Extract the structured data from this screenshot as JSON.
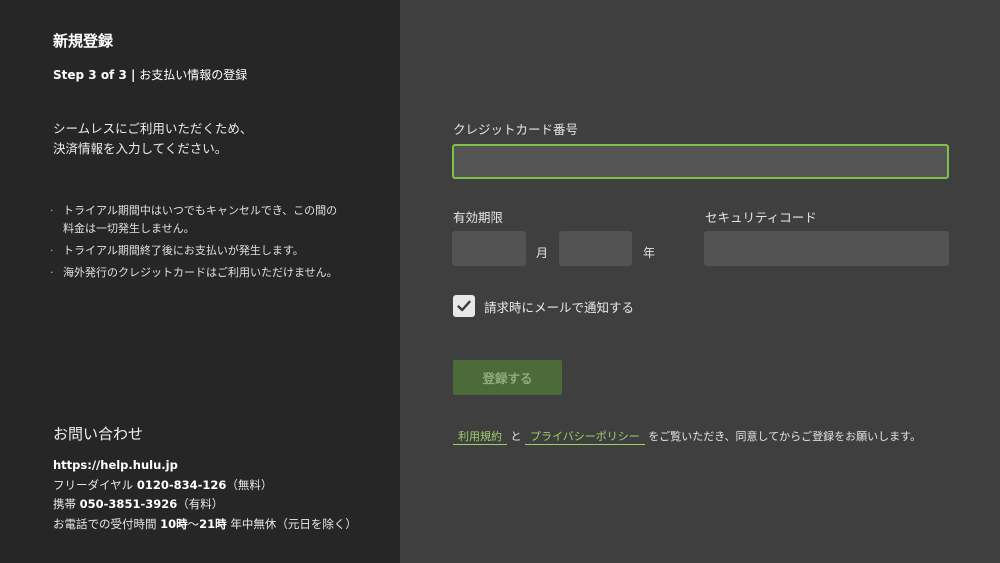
{
  "left": {
    "title": "新規登録",
    "step_prefix": "Step 3 of 3 |",
    "step_text": "お支払い情報の登録",
    "intro_line1": "シームレスにご利用いただくため、",
    "intro_line2": "決済情報を入力してください。",
    "notes": [
      "トライアル期間中はいつでもキャンセルでき、この間の料金は一切発生しません。",
      "トライアル期間終了後にお支払いが発生します。",
      "海外発行のクレジットカードはご利用いただけません。"
    ],
    "contact": {
      "title": "お問い合わせ",
      "url": "https://help.hulu.jp",
      "free_dial_label": "フリーダイヤル",
      "free_dial_number": "0120-834-126",
      "free_dial_note": "（無料）",
      "mobile_label": "携帯",
      "mobile_number": "050-3851-3926",
      "mobile_note": "（有料）",
      "hours_prefix": "お電話での受付時間",
      "hours_start": "10時",
      "hours_sep": "〜",
      "hours_end": "21時",
      "hours_suffix": "年中無休（元日を除く）"
    }
  },
  "form": {
    "card_number_label": "クレジットカード番号",
    "card_number_value": "",
    "expiry_label": "有効期限",
    "month_value": "",
    "month_unit": "月",
    "year_value": "",
    "year_unit": "年",
    "security_label": "セキュリティコード",
    "security_value": "",
    "notify_label": "請求時にメールで通知する",
    "notify_checked": true,
    "submit_label": "登録する",
    "terms_link": "利用規約",
    "terms_and": "と",
    "privacy_link": "プライバシーポリシー",
    "terms_suffix": "をご覧いただき、同意してからご登録をお願いします。"
  },
  "colors": {
    "left_bg": "#262626",
    "right_bg": "#3f3f3f",
    "accent_green": "#7fbf4d",
    "submit_bg": "#4b6b39"
  }
}
